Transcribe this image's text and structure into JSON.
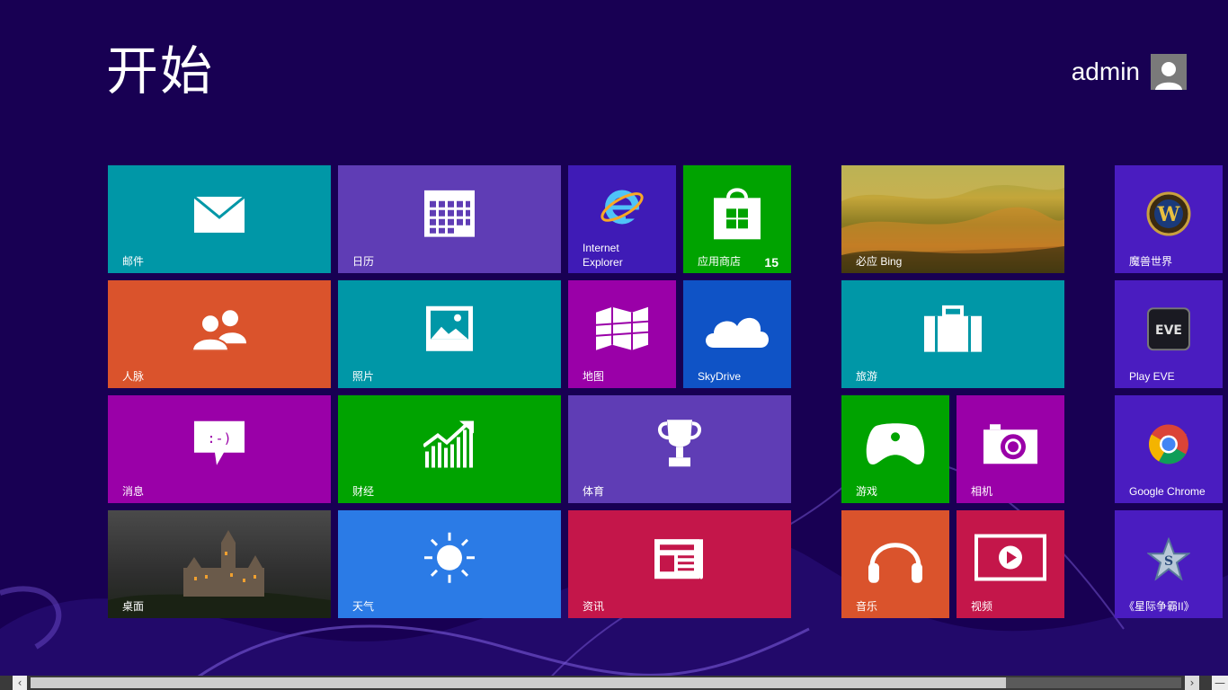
{
  "header": {
    "title": "开始",
    "user_name": "admin"
  },
  "tiles": {
    "mail": {
      "label": "邮件",
      "icon": "mail-icon",
      "color": "#0097A7"
    },
    "calendar": {
      "label": "日历",
      "icon": "calendar-icon",
      "color": "#5F3DB5"
    },
    "ie": {
      "label_line1": "Internet",
      "label_line2": "Explorer",
      "icon": "internet-explorer-icon",
      "color": "#3F1BB6"
    },
    "store": {
      "label": "应用商店",
      "badge": "15",
      "icon": "store-icon",
      "color": "#00A300"
    },
    "bing": {
      "label": "必应 Bing",
      "icon": "landscape-photo"
    },
    "wow": {
      "label": "魔兽世界",
      "icon": "wow-icon",
      "color": "#4A1CC0"
    },
    "people": {
      "label": "人脉",
      "icon": "people-icon",
      "color": "#DA532C"
    },
    "photos": {
      "label": "照片",
      "icon": "photos-icon",
      "color": "#0097A7"
    },
    "maps": {
      "label": "地图",
      "icon": "maps-icon",
      "color": "#9A00A8"
    },
    "skydrive": {
      "label": "SkyDrive",
      "icon": "cloud-icon",
      "color": "#0F53C6"
    },
    "travel": {
      "label": "旅游",
      "icon": "suitcase-icon",
      "color": "#0097A7"
    },
    "eve": {
      "label": "Play EVE",
      "icon": "eve-icon",
      "color": "#4A1CC0"
    },
    "messaging": {
      "label": "消息",
      "icon": "message-icon",
      "color": "#9A00A8"
    },
    "finance": {
      "label": "财经",
      "icon": "finance-chart-icon",
      "color": "#00A300"
    },
    "sports": {
      "label": "体育",
      "icon": "trophy-icon",
      "color": "#5F3DB5"
    },
    "games": {
      "label": "游戏",
      "icon": "xbox-controller-icon",
      "color": "#00A300"
    },
    "camera": {
      "label": "相机",
      "icon": "camera-icon",
      "color": "#9A00A8"
    },
    "chrome": {
      "label": "Google Chrome",
      "icon": "chrome-icon",
      "color": "#4A1CC0"
    },
    "desktop": {
      "label": "桌面",
      "icon": "castle-photo"
    },
    "weather": {
      "label": "天气",
      "icon": "sun-icon",
      "color": "#2B7BE6"
    },
    "news": {
      "label": "资讯",
      "icon": "news-icon",
      "color": "#C4164A"
    },
    "music": {
      "label": "音乐",
      "icon": "headphones-icon",
      "color": "#DA532C"
    },
    "video": {
      "label": "视频",
      "icon": "video-play-icon",
      "color": "#C4164A"
    },
    "starcraft": {
      "label": "《星际争霸II》",
      "icon": "starcraft-icon",
      "color": "#4A1CC0"
    }
  },
  "scrollbar": {
    "left_arrow": "‹",
    "right_arrow": "›",
    "min_label": "—",
    "position": 0.0
  }
}
